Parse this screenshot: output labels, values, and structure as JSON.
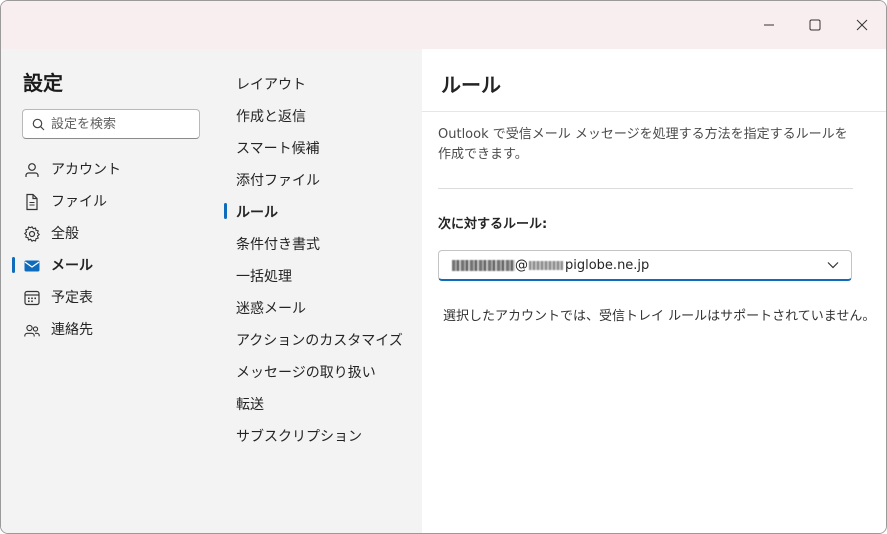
{
  "window": {
    "controls": [
      {
        "name": "minimize-button",
        "icon": "minimize-icon"
      },
      {
        "name": "maximize-button",
        "icon": "maximize-icon"
      },
      {
        "name": "close-button",
        "icon": "close-icon"
      }
    ]
  },
  "sidebar": {
    "title": "設定",
    "search_placeholder": "設定を検索",
    "items": [
      {
        "label": "アカウント",
        "icon": "person-icon",
        "active": false
      },
      {
        "label": "ファイル",
        "icon": "document-icon",
        "active": false
      },
      {
        "label": "全般",
        "icon": "gear-icon",
        "active": false
      },
      {
        "label": "メール",
        "icon": "mail-icon",
        "active": true
      },
      {
        "label": "予定表",
        "icon": "calendar-icon",
        "active": false
      },
      {
        "label": "連絡先",
        "icon": "people-icon",
        "active": false
      }
    ]
  },
  "subnav": {
    "items": [
      {
        "label": "レイアウト",
        "active": false
      },
      {
        "label": "作成と返信",
        "active": false
      },
      {
        "label": "スマート候補",
        "active": false
      },
      {
        "label": "添付ファイル",
        "active": false
      },
      {
        "label": "ルール",
        "active": true
      },
      {
        "label": "条件付き書式",
        "active": false
      },
      {
        "label": "一括処理",
        "active": false
      },
      {
        "label": "迷惑メール",
        "active": false
      },
      {
        "label": "アクションのカスタマイズ",
        "active": false
      },
      {
        "label": "メッセージの取り扱い",
        "active": false
      },
      {
        "label": "転送",
        "active": false
      },
      {
        "label": "サブスクリプション",
        "active": false
      }
    ]
  },
  "content": {
    "heading": "ルール",
    "description": "Outlook で受信メール メッセージを処理する方法を指定するルールを作成できます。",
    "rules_for_label": "次に対するルール:",
    "account_dropdown": {
      "value_visible": "@",
      "value_domain": "piglobe.ne.jp"
    },
    "notice": "選択したアカウントでは、受信トレイ ルールはサポートされていません。"
  },
  "colors": {
    "accent": "#0f6cbd",
    "titlebar_bg": "#f8eeef",
    "nav_bg": "#f3f3f3"
  }
}
